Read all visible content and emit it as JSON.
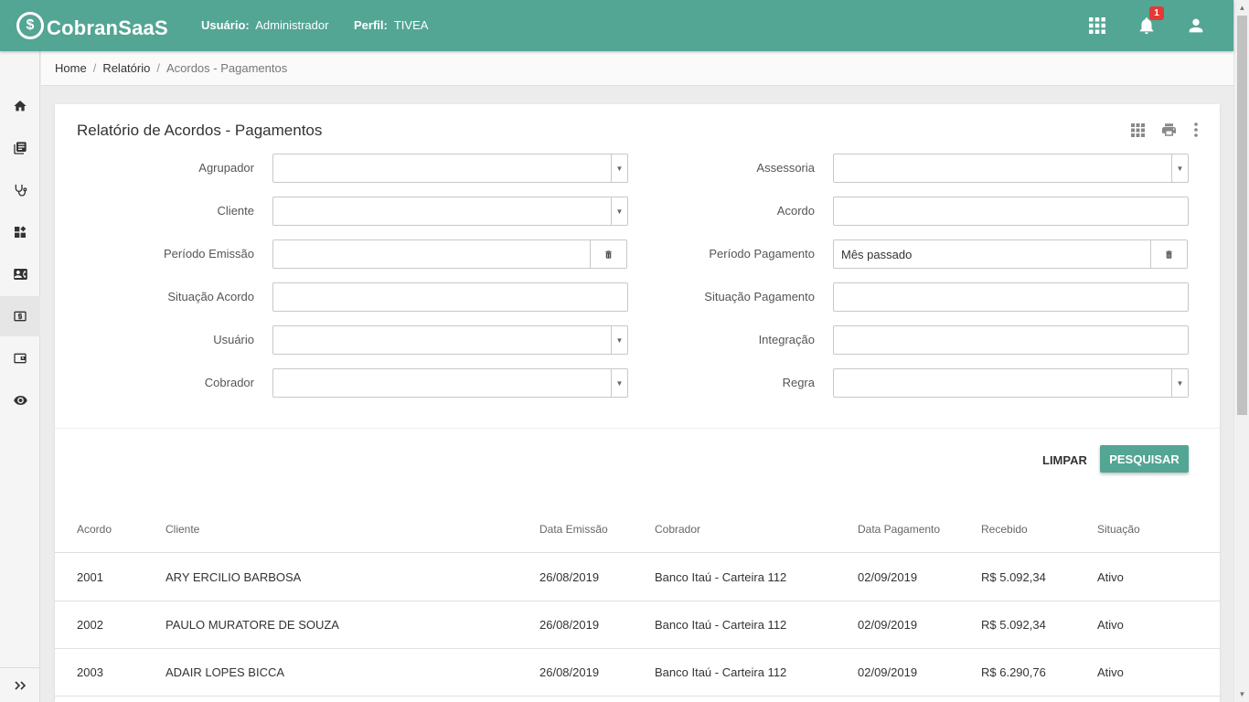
{
  "header": {
    "logo_mark": "$",
    "app_name": "CobranSaaS",
    "user_label": "Usuário:",
    "user_value": "Administrador",
    "perfil_label": "Perfil:",
    "perfil_value": "TIVEA",
    "notification_count": "1",
    "icons": [
      "apps-grid-icon",
      "bell-icon",
      "user-icon"
    ]
  },
  "sidebar": {
    "items": [
      "home-icon",
      "library-icon",
      "stethoscope-icon",
      "dashboard-add-icon",
      "contact-card-icon",
      "money-icon",
      "wallet-icon",
      "eye-icon"
    ],
    "active_index": 5,
    "expand_icon": "double-chevron-right-icon"
  },
  "breadcrumb": {
    "items": [
      "Home",
      "Relatório"
    ],
    "current": "Acordos - Pagamentos"
  },
  "card": {
    "title": "Relatório de Acordos - Pagamentos",
    "tools": [
      "grid-icon",
      "print-icon",
      "more-vert-icon"
    ]
  },
  "filters": {
    "agrupador": {
      "label": "Agrupador",
      "value": ""
    },
    "cliente": {
      "label": "Cliente",
      "value": ""
    },
    "periodo_emissao": {
      "label": "Período Emissão",
      "value": ""
    },
    "situacao_acordo": {
      "label": "Situação Acordo",
      "value": ""
    },
    "usuario": {
      "label": "Usuário",
      "value": ""
    },
    "cobrador": {
      "label": "Cobrador",
      "value": ""
    },
    "assessoria": {
      "label": "Assessoria",
      "value": ""
    },
    "acordo": {
      "label": "Acordo",
      "value": ""
    },
    "periodo_pagamento": {
      "label": "Período Pagamento",
      "value": "Mês passado"
    },
    "situacao_pagamento": {
      "label": "Situação Pagamento",
      "value": ""
    },
    "integracao": {
      "label": "Integração",
      "value": ""
    },
    "regra": {
      "label": "Regra",
      "value": ""
    }
  },
  "actions": {
    "clear_label": "LIMPAR",
    "search_label": "PESQUISAR"
  },
  "table": {
    "columns": [
      "Acordo",
      "Cliente",
      "Data Emissão",
      "Cobrador",
      "Data Pagamento",
      "Recebido",
      "Situação"
    ],
    "rows": [
      [
        "2001",
        "ARY ERCILIO BARBOSA",
        "26/08/2019",
        "Banco Itaú - Carteira 112",
        "02/09/2019",
        "R$ 5.092,34",
        "Ativo"
      ],
      [
        "2002",
        "PAULO MURATORE DE SOUZA",
        "26/08/2019",
        "Banco Itaú - Carteira 112",
        "02/09/2019",
        "R$ 5.092,34",
        "Ativo"
      ],
      [
        "2003",
        "ADAIR LOPES BICCA",
        "26/08/2019",
        "Banco Itaú - Carteira 112",
        "02/09/2019",
        "R$ 6.290,76",
        "Ativo"
      ]
    ]
  },
  "colors": {
    "primary": "#53a594",
    "badge": "#e53935"
  }
}
